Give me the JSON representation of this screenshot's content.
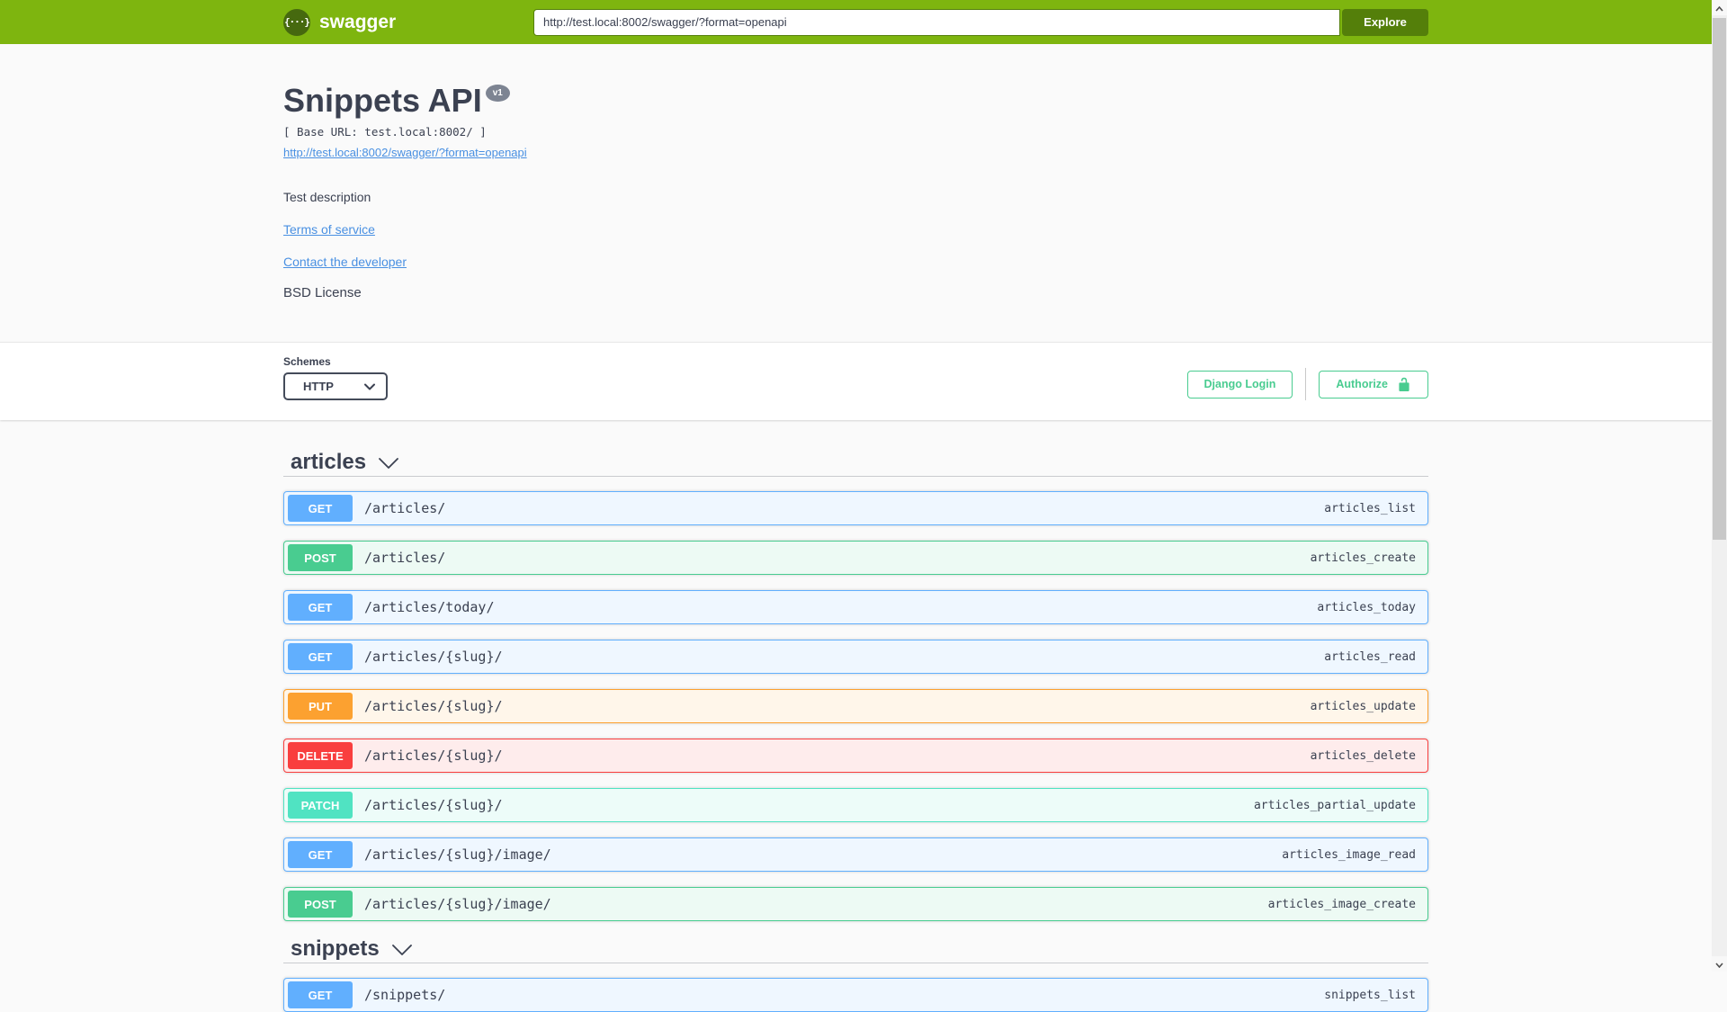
{
  "topbar": {
    "logo_glyph": "{···}",
    "logo_text": "swagger",
    "url_value": "http://test.local:8002/swagger/?format=openapi",
    "explore_label": "Explore"
  },
  "info": {
    "title": "Snippets API",
    "version_badge": "v1",
    "base_url": "[ Base URL: test.local:8002/ ]",
    "spec_link": "http://test.local:8002/swagger/?format=openapi",
    "description": "Test description",
    "terms_link": "Terms of service",
    "contact_link": "Contact the developer",
    "license": "BSD License"
  },
  "scheme": {
    "label": "Schemes",
    "selected": "HTTP",
    "django_login_label": "Django Login",
    "authorize_label": "Authorize"
  },
  "colors": {
    "topbar": "#7eb50f",
    "logo_circle": "#46690f",
    "explore": "#547f0a",
    "accent_green": "#49cc90",
    "link_blue": "#4990e2",
    "get": "#61affe",
    "get_bg": "#eff7ff",
    "post": "#49cc90",
    "post_bg": "#edfaf4",
    "put": "#fca130",
    "put_bg": "#fff6ea",
    "delete": "#f93e3e",
    "delete_bg": "#feecec",
    "patch": "#50e3c2",
    "patch_bg": "#edfcf9"
  },
  "sections": [
    {
      "name": "articles",
      "operations": [
        {
          "method": "GET",
          "path": "/articles/",
          "operation_id": "articles_list"
        },
        {
          "method": "POST",
          "path": "/articles/",
          "operation_id": "articles_create"
        },
        {
          "method": "GET",
          "path": "/articles/today/",
          "operation_id": "articles_today"
        },
        {
          "method": "GET",
          "path": "/articles/{slug}/",
          "operation_id": "articles_read"
        },
        {
          "method": "PUT",
          "path": "/articles/{slug}/",
          "operation_id": "articles_update"
        },
        {
          "method": "DELETE",
          "path": "/articles/{slug}/",
          "operation_id": "articles_delete"
        },
        {
          "method": "PATCH",
          "path": "/articles/{slug}/",
          "operation_id": "articles_partial_update"
        },
        {
          "method": "GET",
          "path": "/articles/{slug}/image/",
          "operation_id": "articles_image_read"
        },
        {
          "method": "POST",
          "path": "/articles/{slug}/image/",
          "operation_id": "articles_image_create"
        }
      ]
    },
    {
      "name": "snippets",
      "operations": [
        {
          "method": "GET",
          "path": "/snippets/",
          "operation_id": "snippets_list"
        }
      ]
    }
  ]
}
